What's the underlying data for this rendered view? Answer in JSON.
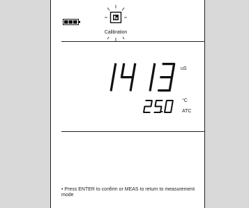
{
  "status": {
    "mode_label": "Calibration",
    "battery_icon": "battery-full-icon",
    "mode_icon": "calibration-icon"
  },
  "display": {
    "primary_value": "1413",
    "primary_unit": "uS",
    "secondary_value": "25.0",
    "secondary_unit": "°C",
    "compensation": "ATC"
  },
  "instructions": {
    "text": "• Press ENTER to confirm or MEAS to return to measurement mode"
  }
}
